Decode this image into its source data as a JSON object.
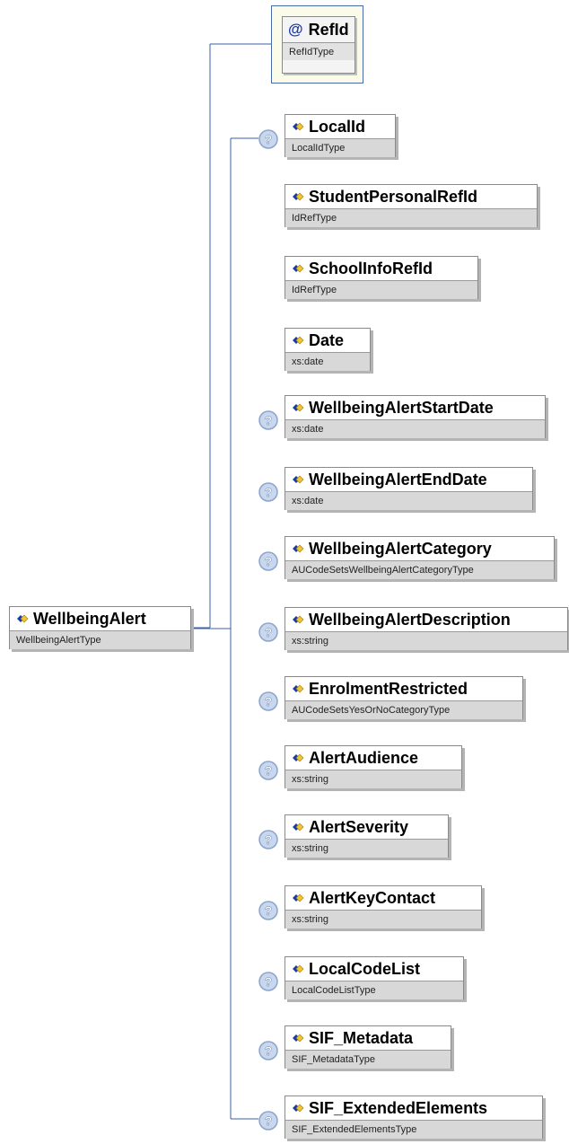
{
  "root": {
    "name": "WellbeingAlert",
    "type": "WellbeingAlertType"
  },
  "attribute": {
    "symbol": "@",
    "name": "RefId",
    "type": "RefIdType"
  },
  "elements": [
    {
      "name": "LocalId",
      "type": "LocalIdType",
      "optional": true
    },
    {
      "name": "StudentPersonalRefId",
      "type": "IdRefType",
      "optional": false
    },
    {
      "name": "SchoolInfoRefId",
      "type": "IdRefType",
      "optional": false
    },
    {
      "name": "Date",
      "type": "xs:date",
      "optional": false
    },
    {
      "name": "WellbeingAlertStartDate",
      "type": "xs:date",
      "optional": true
    },
    {
      "name": "WellbeingAlertEndDate",
      "type": "xs:date",
      "optional": true
    },
    {
      "name": "WellbeingAlertCategory",
      "type": "AUCodeSetsWellbeingAlertCategoryType",
      "optional": true
    },
    {
      "name": "WellbeingAlertDescription",
      "type": "xs:string",
      "optional": true
    },
    {
      "name": "EnrolmentRestricted",
      "type": "AUCodeSetsYesOrNoCategoryType",
      "optional": true
    },
    {
      "name": "AlertAudience",
      "type": "xs:string",
      "optional": true
    },
    {
      "name": "AlertSeverity",
      "type": "xs:string",
      "optional": true
    },
    {
      "name": "AlertKeyContact",
      "type": "xs:string",
      "optional": true
    },
    {
      "name": "LocalCodeList",
      "type": "LocalCodeListType",
      "optional": true
    },
    {
      "name": "SIF_Metadata",
      "type": "SIF_MetadataType",
      "optional": true
    },
    {
      "name": "SIF_ExtendedElements",
      "type": "SIF_ExtendedElementsType",
      "optional": true
    }
  ],
  "icons": {
    "element": "element-diamond-icon",
    "optional": "optional-question-icon",
    "attribute": "attribute-at-icon"
  },
  "colors": {
    "connector": "#3b62a8",
    "attribute_border": "#4a6aa8",
    "attribute_fill": "#fbfbe9",
    "type_bar": "#d8d8d8",
    "optional_badge": "#8aa4cc"
  }
}
